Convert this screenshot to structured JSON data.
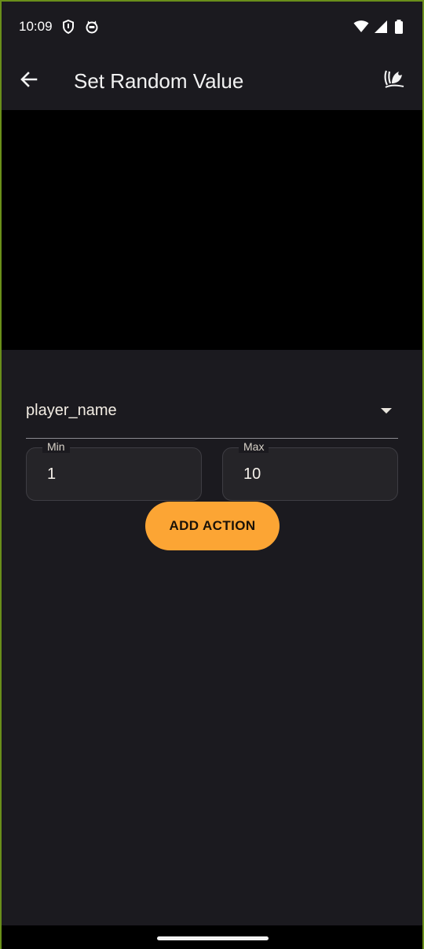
{
  "status_bar": {
    "time": "10:09",
    "icons_left": [
      "shield-icon",
      "cat-face-icon"
    ],
    "icons_right": [
      "wifi-icon",
      "cell-signal-icon",
      "battery-icon"
    ]
  },
  "app_bar": {
    "title": "Set Random Value",
    "back_icon": "arrow-back-icon",
    "action_icon": "app-logo-icon"
  },
  "dropdown": {
    "selected": "player_name"
  },
  "min_field": {
    "label": "Min",
    "value": "1"
  },
  "max_field": {
    "label": "Max",
    "value": "10"
  },
  "add_button": {
    "label": "ADD ACTION"
  },
  "colors": {
    "background": "#1b1a1f",
    "accent": "#fca534",
    "media_area": "#000000"
  }
}
